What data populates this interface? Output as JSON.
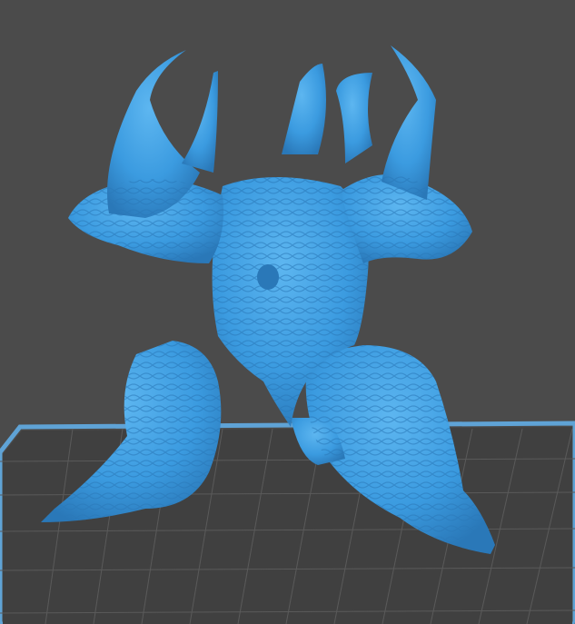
{
  "viewport": {
    "background_color": "#4b4b4b",
    "plate_color": "#404040",
    "plate_grid_color": "#5a5a5a",
    "plate_border_color": "#5fa3d6",
    "model_color": "#3b9be0",
    "model_shade_color": "#2a78b8",
    "model_highlight_color": "#6cc0f5"
  }
}
